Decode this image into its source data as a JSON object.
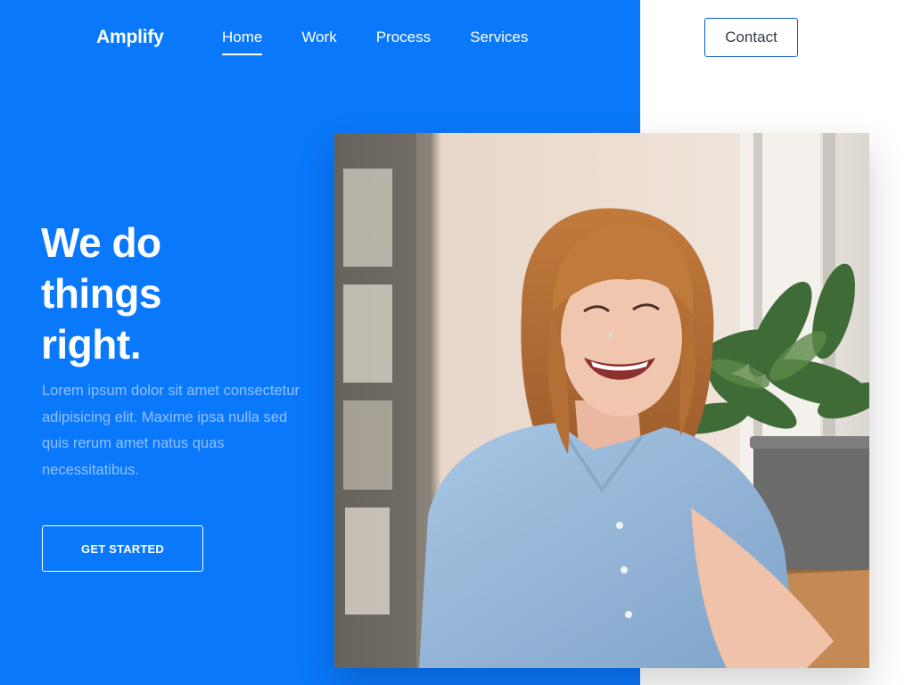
{
  "header": {
    "brand": "Amplify",
    "nav": [
      {
        "label": "Home",
        "active": true
      },
      {
        "label": "Work",
        "active": false
      },
      {
        "label": "Process",
        "active": false
      },
      {
        "label": "Services",
        "active": false
      }
    ],
    "contact_label": "Contact"
  },
  "hero": {
    "title_lines": [
      "We do",
      "things",
      "right."
    ],
    "description": "Lorem ipsum dolor sit amet consectetur adipisicing elit. Maxime ipsa nulla sed quis rerum amet natus quas necessitatibus.",
    "cta_label": "GET STARTED"
  },
  "colors": {
    "brand_blue": "#0a78fb",
    "white": "#ffffff",
    "description_text": "#8fc0ff"
  }
}
